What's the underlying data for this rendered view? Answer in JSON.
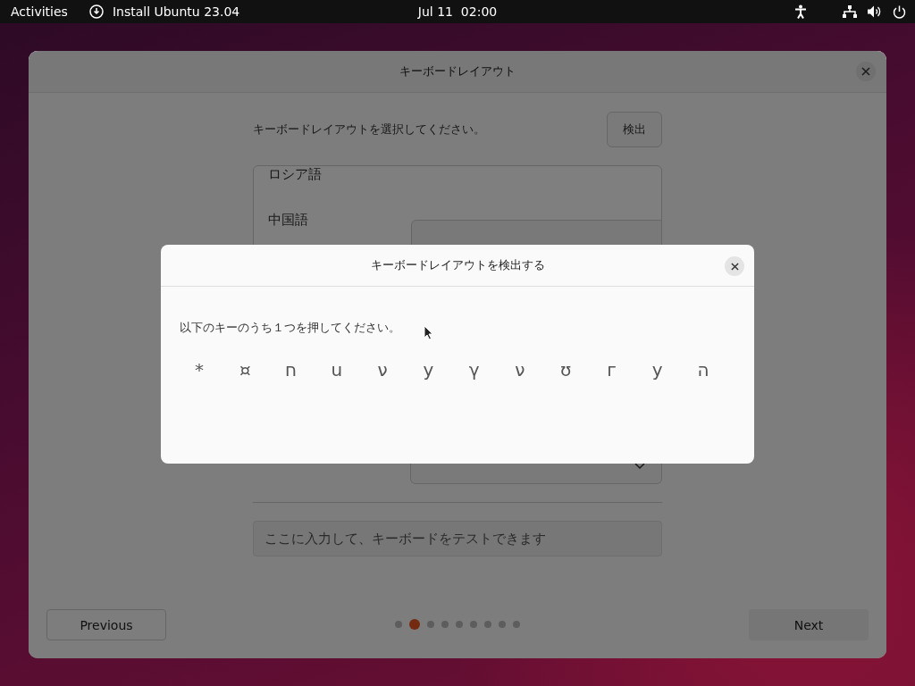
{
  "top_bar": {
    "activities": "Activities",
    "app_menu": "Install Ubuntu 23.04",
    "clock": "Jul 11  02:00"
  },
  "window": {
    "title": "キーボードレイアウト",
    "prompt": "キーボードレイアウトを選択してください。",
    "detect_button": "検出",
    "layouts": [
      "ロシア語",
      "中国語"
    ],
    "test_field": {
      "placeholder": "ここに入力して、キーボードをテストできます"
    },
    "previous_button": "Previous",
    "next_button": "Next",
    "steps": [
      {
        "selected": false
      },
      {
        "selected": true
      },
      {
        "selected": false
      },
      {
        "selected": false
      },
      {
        "selected": false
      },
      {
        "selected": false
      },
      {
        "selected": false
      },
      {
        "selected": false
      },
      {
        "selected": false
      }
    ]
  },
  "dialog": {
    "title": "キーボードレイアウトを検出する",
    "instruction": "以下のキーのうち１つを押してください。",
    "keys": [
      "*",
      "¤",
      "ח",
      "ս",
      "ν",
      "у",
      "γ",
      "ν",
      "ʊ",
      "г",
      "у",
      "ה"
    ]
  }
}
